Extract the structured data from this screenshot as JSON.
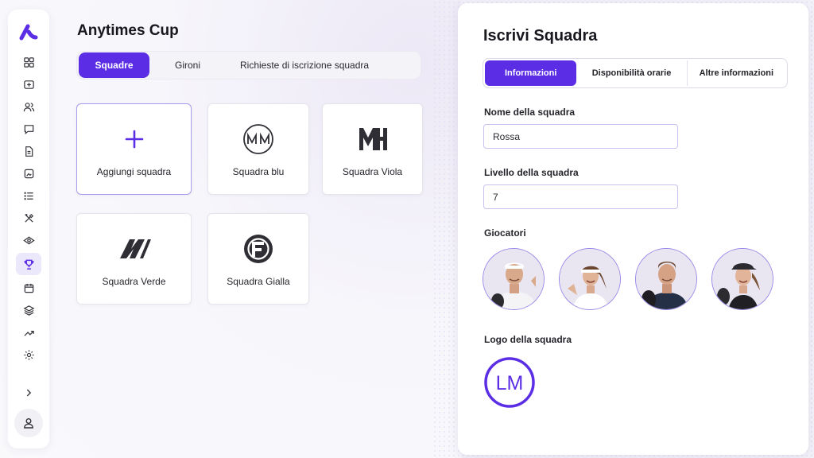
{
  "tournament": {
    "title": "Anytimes Cup"
  },
  "main_tabs": [
    {
      "label": "Squadre",
      "active": true
    },
    {
      "label": "Gironi",
      "active": false
    },
    {
      "label": "Richieste di iscrizione squadra",
      "active": false
    }
  ],
  "cards": {
    "add": {
      "label": "Aggiungi squadra",
      "icon": "plus-icon"
    },
    "teams": [
      {
        "label": "Squadra blu",
        "icon": "mm-logo-icon"
      },
      {
        "label": "Squadra Viola",
        "icon": "mh-logo-icon"
      },
      {
        "label": "Squadra Verde",
        "icon": "n-logo-icon"
      },
      {
        "label": "Squadra Gialla",
        "icon": "f-logo-icon"
      }
    ]
  },
  "sidebar": {
    "items": [
      "dashboard-icon",
      "add-box-icon",
      "users-icon",
      "chat-icon",
      "document-icon",
      "image-icon",
      "list-icon",
      "tools-icon",
      "eye-icon",
      "trophy-icon",
      "calendar-icon",
      "layers-icon",
      "trending-icon",
      "settings-icon"
    ],
    "active": "trophy-icon"
  },
  "panel": {
    "title": "Iscrivi Squadra",
    "tabs": [
      {
        "label": "Informazioni",
        "active": true
      },
      {
        "label": "Disponibilità orarie",
        "active": false
      },
      {
        "label": "Altre informazioni",
        "active": false
      }
    ],
    "team_name": {
      "label": "Nome della squadra",
      "value": "Rossa"
    },
    "team_level": {
      "label": "Livello della squadra",
      "value": "7"
    },
    "players_label": "Giocatori",
    "logo_label": "Logo della squadra",
    "logo_text": "LM"
  },
  "colors": {
    "accent": "#5b2ee6",
    "accent_light": "#ece8fb",
    "border": "#c9c1ee"
  }
}
